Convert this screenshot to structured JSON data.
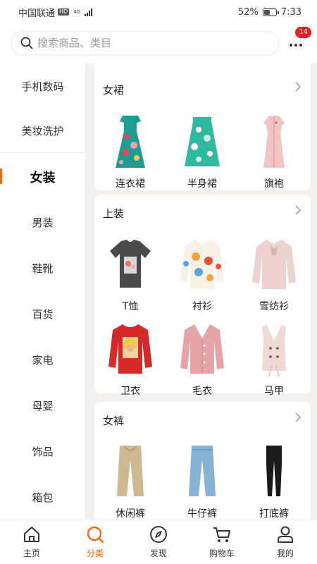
{
  "status_bar": {
    "carrier": "中国联通",
    "hd": "HD",
    "net": "4G",
    "battery": "52%",
    "time": "7:33",
    "battery_level": 0.52
  },
  "search": {
    "placeholder": "搜索商品、类目",
    "notification_count": "14"
  },
  "sidebar": {
    "items": [
      {
        "label": "手机数码",
        "active": false
      },
      {
        "label": "美妆洗护",
        "active": false
      },
      {
        "label": "女装",
        "active": true
      },
      {
        "label": "男装",
        "active": false
      },
      {
        "label": "鞋靴",
        "active": false
      },
      {
        "label": "百货",
        "active": false
      },
      {
        "label": "家电",
        "active": false
      },
      {
        "label": "母婴",
        "active": false
      },
      {
        "label": "饰品",
        "active": false
      },
      {
        "label": "箱包",
        "active": false
      }
    ]
  },
  "sections": [
    {
      "title": "女裙",
      "items": [
        {
          "label": "连衣裙",
          "icon": "floral-dress-icon"
        },
        {
          "label": "半身裙",
          "icon": "skirt-icon"
        },
        {
          "label": "旗袍",
          "icon": "qipao-icon"
        }
      ]
    },
    {
      "title": "上装",
      "items": [
        {
          "label": "T恤",
          "icon": "tshirt-icon"
        },
        {
          "label": "衬衫",
          "icon": "shirt-icon"
        },
        {
          "label": "雪纺衫",
          "icon": "chiffon-blouse-icon"
        },
        {
          "label": "卫衣",
          "icon": "sweatshirt-icon"
        },
        {
          "label": "毛衣",
          "icon": "sweater-icon"
        },
        {
          "label": "马甲",
          "icon": "vest-icon"
        }
      ]
    },
    {
      "title": "女裤",
      "items": [
        {
          "label": "休闲裤",
          "icon": "casual-pants-icon"
        },
        {
          "label": "牛仔裤",
          "icon": "jeans-icon"
        },
        {
          "label": "打底裤",
          "icon": "leggings-icon"
        }
      ]
    }
  ],
  "tabbar": {
    "items": [
      {
        "label": "主页",
        "icon": "home-icon",
        "active": false
      },
      {
        "label": "分类",
        "icon": "category-search-icon",
        "active": true
      },
      {
        "label": "发现",
        "icon": "compass-icon",
        "active": false
      },
      {
        "label": "购物车",
        "icon": "cart-icon",
        "active": false
      },
      {
        "label": "我的",
        "icon": "profile-icon",
        "active": false
      }
    ]
  },
  "colors": {
    "accent": "#f2661a",
    "badge": "#e02020",
    "background": "#f3f0ee"
  }
}
